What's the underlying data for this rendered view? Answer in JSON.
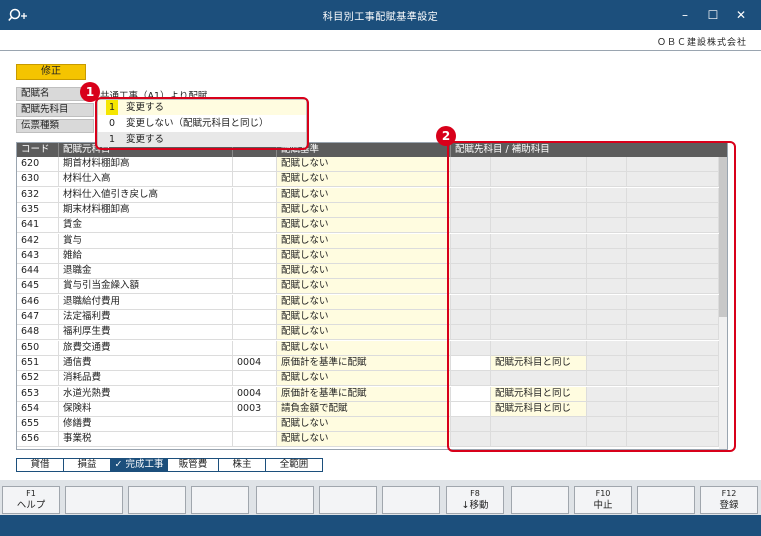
{
  "window": {
    "title": "科目別工事配賦基準設定",
    "minimize": "–",
    "maximize": "☐",
    "close": "✕"
  },
  "company": "ＯＢＣ建設株式会社",
  "mode_button": "修正",
  "header": {
    "name_label": "配賦名",
    "name_value": "共通工事（A1）より配賦",
    "target_label": "配賦先科目",
    "voucher_label": "伝票種類"
  },
  "dropdown": {
    "current_code": "1",
    "current_text": "変更する",
    "options": [
      {
        "code": "0",
        "text": "変更しない（配賦元科目と同じ）"
      },
      {
        "code": "1",
        "text": "変更する"
      }
    ]
  },
  "callouts": {
    "one": "1",
    "two": "2"
  },
  "table": {
    "headers": [
      "コード",
      "配賦元科目",
      "",
      "配賦基準",
      "配賦先科目 / 補助科目"
    ],
    "rows": [
      {
        "code": "620",
        "name": "期首材料棚卸高",
        "sub": "",
        "basis": "配賦しない",
        "target": ""
      },
      {
        "code": "630",
        "name": "材料仕入高",
        "sub": "",
        "basis": "配賦しない",
        "target": ""
      },
      {
        "code": "632",
        "name": "材料仕入値引き戻し高",
        "sub": "",
        "basis": "配賦しない",
        "target": ""
      },
      {
        "code": "635",
        "name": "期末材料棚卸高",
        "sub": "",
        "basis": "配賦しない",
        "target": ""
      },
      {
        "code": "641",
        "name": "賃金",
        "sub": "",
        "basis": "配賦しない",
        "target": ""
      },
      {
        "code": "642",
        "name": "賞与",
        "sub": "",
        "basis": "配賦しない",
        "target": ""
      },
      {
        "code": "643",
        "name": "雑給",
        "sub": "",
        "basis": "配賦しない",
        "target": ""
      },
      {
        "code": "644",
        "name": "退職金",
        "sub": "",
        "basis": "配賦しない",
        "target": ""
      },
      {
        "code": "645",
        "name": "賞与引当金繰入額",
        "sub": "",
        "basis": "配賦しない",
        "target": ""
      },
      {
        "code": "646",
        "name": "退職給付費用",
        "sub": "",
        "basis": "配賦しない",
        "target": ""
      },
      {
        "code": "647",
        "name": "法定福利費",
        "sub": "",
        "basis": "配賦しない",
        "target": ""
      },
      {
        "code": "648",
        "name": "福利厚生費",
        "sub": "",
        "basis": "配賦しない",
        "target": ""
      },
      {
        "code": "650",
        "name": "旅費交通費",
        "sub": "",
        "basis": "配賦しない",
        "target": ""
      },
      {
        "code": "651",
        "name": "通信費",
        "sub": "0004",
        "basis": "原価計を基準に配賦",
        "target": "配賦元科目と同じ"
      },
      {
        "code": "652",
        "name": "消耗品費",
        "sub": "",
        "basis": "配賦しない",
        "target": ""
      },
      {
        "code": "653",
        "name": "水道光熱費",
        "sub": "0004",
        "basis": "原価計を基準に配賦",
        "target": "配賦元科目と同じ"
      },
      {
        "code": "654",
        "name": "保険料",
        "sub": "0003",
        "basis": "請負金額で配賦",
        "target": "配賦元科目と同じ"
      },
      {
        "code": "655",
        "name": "修繕費",
        "sub": "",
        "basis": "配賦しない",
        "target": ""
      },
      {
        "code": "656",
        "name": "事業税",
        "sub": "",
        "basis": "配賦しない",
        "target": ""
      }
    ]
  },
  "tabs": [
    {
      "label": "貸借",
      "active": false
    },
    {
      "label": "損益",
      "active": false
    },
    {
      "label": "✓ 完成工事",
      "active": true
    },
    {
      "label": "販管費",
      "active": false
    },
    {
      "label": "株主",
      "active": false
    },
    {
      "label": "全範囲",
      "active": false
    }
  ],
  "function_keys": [
    {
      "key": "F1",
      "label": "ヘルプ"
    },
    {
      "key": "",
      "label": ""
    },
    {
      "key": "",
      "label": ""
    },
    {
      "key": "",
      "label": ""
    },
    {
      "key": "",
      "label": ""
    },
    {
      "key": "",
      "label": ""
    },
    {
      "key": "",
      "label": ""
    },
    {
      "key": "F8",
      "label": "↓移動"
    },
    {
      "key": "",
      "label": ""
    },
    {
      "key": "F10",
      "label": "中止"
    },
    {
      "key": "",
      "label": ""
    },
    {
      "key": "F12",
      "label": "登録"
    }
  ]
}
